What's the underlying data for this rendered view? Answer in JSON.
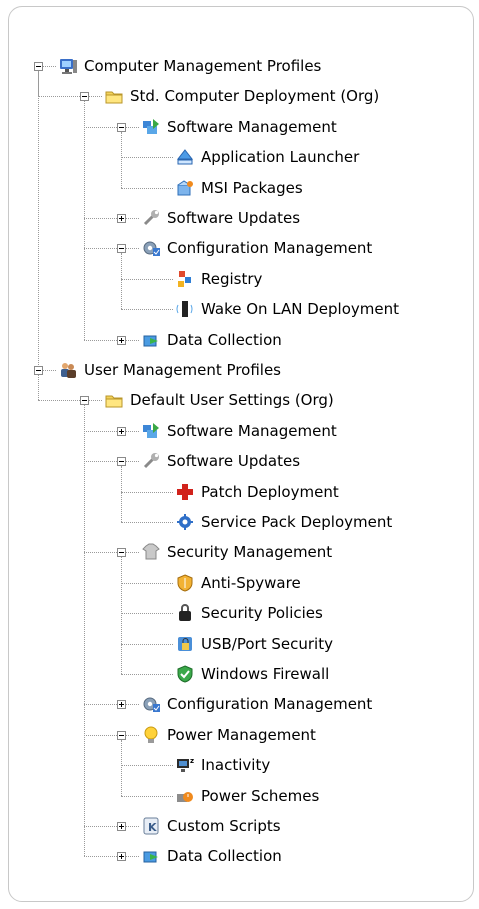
{
  "tree": [
    {
      "label": "Computer Management Profiles",
      "icon": "computer-monitor-icon",
      "level": 0,
      "expander": "minus"
    },
    {
      "label": "Std. Computer Deployment (Org)",
      "icon": "folder-icon",
      "level": 1,
      "expander": "minus"
    },
    {
      "label": "Software Management",
      "icon": "software-management-icon",
      "level": 2,
      "expander": "minus"
    },
    {
      "label": "Application Launcher",
      "icon": "application-launcher-icon",
      "level": 3,
      "expander": "none"
    },
    {
      "label": "MSI Packages",
      "icon": "msi-package-icon",
      "level": 3,
      "expander": "none"
    },
    {
      "label": "Software Updates",
      "icon": "wrench-icon",
      "level": 2,
      "expander": "plus"
    },
    {
      "label": "Configuration Management",
      "icon": "configuration-gear-icon",
      "level": 2,
      "expander": "minus"
    },
    {
      "label": "Registry",
      "icon": "registry-icon",
      "level": 3,
      "expander": "none"
    },
    {
      "label": "Wake On LAN Deployment",
      "icon": "wake-on-lan-icon",
      "level": 3,
      "expander": "none"
    },
    {
      "label": "Data Collection",
      "icon": "data-collection-icon",
      "level": 2,
      "expander": "plus"
    },
    {
      "label": "User Management Profiles",
      "icon": "users-icon",
      "level": 0,
      "expander": "minus"
    },
    {
      "label": "Default User Settings (Org)",
      "icon": "folder-icon",
      "level": 1,
      "expander": "minus"
    },
    {
      "label": "Software Management",
      "icon": "software-management-icon",
      "level": 2,
      "expander": "plus"
    },
    {
      "label": "Software Updates",
      "icon": "wrench-icon",
      "level": 2,
      "expander": "minus"
    },
    {
      "label": "Patch Deployment",
      "icon": "patch-cross-icon",
      "level": 3,
      "expander": "none"
    },
    {
      "label": "Service Pack Deployment",
      "icon": "service-pack-icon",
      "level": 3,
      "expander": "none"
    },
    {
      "label": "Security Management",
      "icon": "security-shirt-icon",
      "level": 2,
      "expander": "minus"
    },
    {
      "label": "Anti-Spyware",
      "icon": "anti-spyware-shield-icon",
      "level": 3,
      "expander": "none"
    },
    {
      "label": "Security Policies",
      "icon": "security-lock-icon",
      "level": 3,
      "expander": "none"
    },
    {
      "label": "USB/Port Security",
      "icon": "usb-lock-icon",
      "level": 3,
      "expander": "none"
    },
    {
      "label": "Windows Firewall",
      "icon": "firewall-check-shield-icon",
      "level": 3,
      "expander": "none"
    },
    {
      "label": "Configuration Management",
      "icon": "configuration-gear-icon",
      "level": 2,
      "expander": "plus"
    },
    {
      "label": "Power Management",
      "icon": "lightbulb-icon",
      "level": 2,
      "expander": "minus"
    },
    {
      "label": "Inactivity",
      "icon": "inactivity-monitor-icon",
      "level": 3,
      "expander": "none"
    },
    {
      "label": "Power Schemes",
      "icon": "power-schemes-icon",
      "level": 3,
      "expander": "none"
    },
    {
      "label": "Custom Scripts",
      "icon": "custom-scripts-icon",
      "level": 2,
      "expander": "plus"
    },
    {
      "label": "Data Collection",
      "icon": "data-collection-icon",
      "level": 2,
      "expander": "plus"
    }
  ]
}
